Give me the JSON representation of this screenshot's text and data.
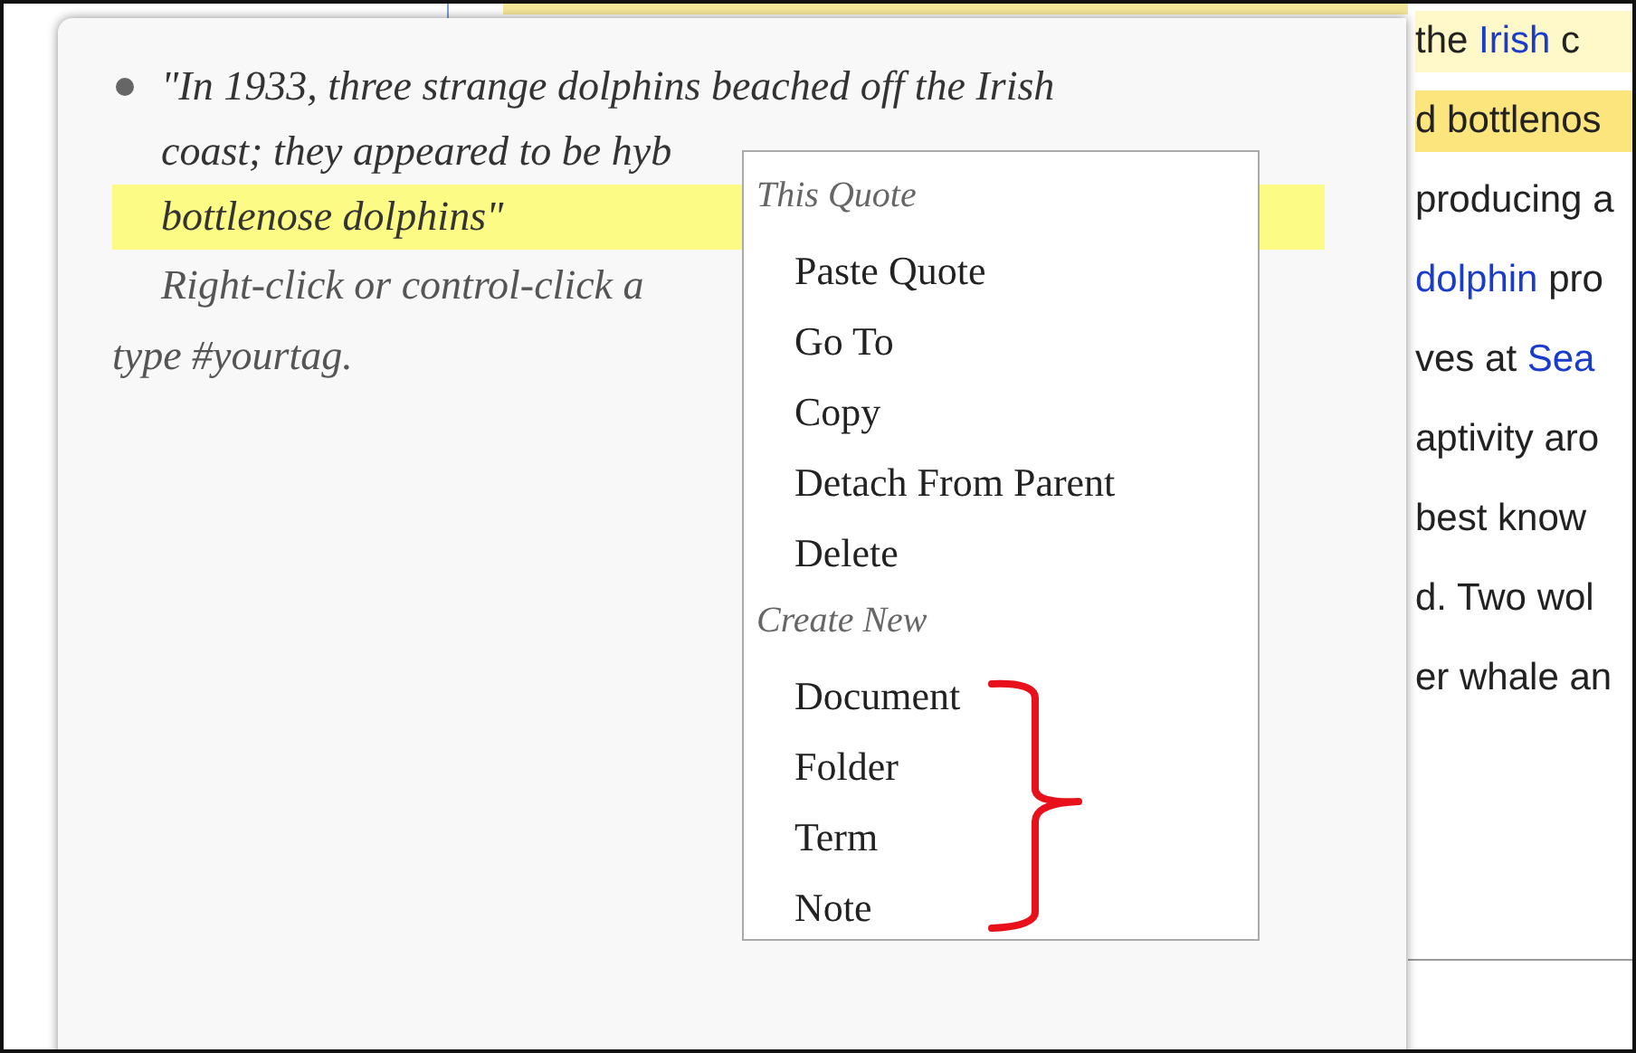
{
  "article_lines": [
    {
      "color": "#fff8c8",
      "segments": [
        {
          "text": "the ",
          "link": false
        },
        {
          "text": "Irish",
          "link": true
        },
        {
          "text": " c",
          "link": false
        }
      ]
    },
    {
      "color": "#fde57e",
      "segments": [
        {
          "text": "d bottlenos",
          "link": false
        }
      ]
    },
    {
      "segments": [
        {
          "text": "producing a",
          "link": false
        }
      ]
    },
    {
      "segments": [
        {
          "text": "dolphin",
          "link": true
        },
        {
          "text": " pro",
          "link": false
        }
      ]
    },
    {
      "segments": [
        {
          "text": "ves at ",
          "link": false
        },
        {
          "text": "Sea",
          "link": true
        }
      ]
    },
    {
      "segments": [
        {
          "text": "aptivity aro",
          "link": false
        }
      ]
    },
    {
      "segments": [
        {
          "text": " best know",
          "link": false
        }
      ]
    },
    {
      "segments": [
        {
          "text": "d. Two wol",
          "link": false
        }
      ]
    },
    {
      "segments": [
        {
          "text": "er whale an",
          "link": false
        }
      ]
    }
  ],
  "quote_card": {
    "quote_lines": [
      {
        "text": "\"In 1933, three strange dolphins beached off the Irish",
        "highlighted": false
      },
      {
        "text": "coast; they appeared to be hyb",
        "highlighted": false
      },
      {
        "text": "bottlenose dolphins\"",
        "highlighted": true
      }
    ],
    "hint_lines": [
      "Right-click or control-click a",
      "type #yourtag."
    ]
  },
  "context_menu": {
    "sections": [
      {
        "title": "This Quote",
        "items": [
          "Paste Quote",
          "Go To",
          "Copy",
          "Detach From Parent",
          "Delete"
        ]
      },
      {
        "title": "Create New",
        "items": [
          "Document",
          "Folder",
          "Term",
          "Note"
        ]
      }
    ]
  }
}
